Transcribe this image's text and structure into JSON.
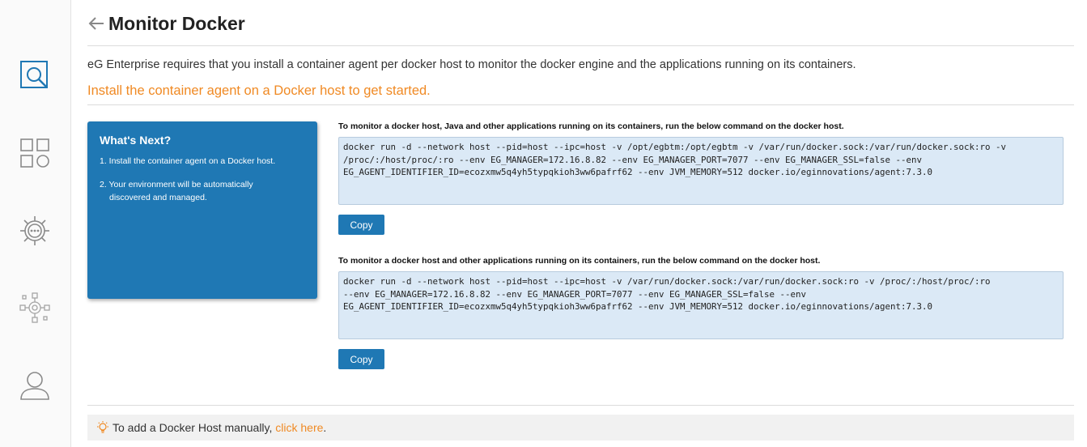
{
  "page": {
    "title": "Monitor Docker",
    "intro": "eG Enterprise requires that you install a container agent per docker host to monitor the docker engine and the applications running on its containers.",
    "cta": "Install the container agent on a Docker host to get started."
  },
  "sidebar": {
    "items": [
      {
        "name": "monitor",
        "icon": "search-monitor-icon"
      },
      {
        "name": "dashboards",
        "icon": "grid-icon"
      },
      {
        "name": "admin",
        "icon": "gear-icon"
      },
      {
        "name": "configure",
        "icon": "network-gear-icon"
      },
      {
        "name": "user",
        "icon": "user-icon"
      }
    ]
  },
  "whats_next": {
    "title": "What's Next?",
    "step1": "1. Install the container agent on a Docker host.",
    "step2": "2. Your environment will be automatically discovered and managed."
  },
  "commands": [
    {
      "label": "To monitor a docker host, Java and other applications running on its containers, run the below command on the docker host.",
      "command": "docker run -d --network host --pid=host --ipc=host -v /opt/egbtm:/opt/egbtm -v /var/run/docker.sock:/var/run/docker.sock:ro -v\n/proc/:/host/proc/:ro --env EG_MANAGER=172.16.8.82 --env EG_MANAGER_PORT=7077 --env EG_MANAGER_SSL=false --env\nEG_AGENT_IDENTIFIER_ID=ecozxmw5q4yh5typqkioh3ww6pafrf62 --env JVM_MEMORY=512 docker.io/eginnovations/agent:7.3.0",
      "copy_label": "Copy"
    },
    {
      "label": "To monitor a docker host and other applications running on its containers, run the below command on the docker host.",
      "command": "docker run -d --network host --pid=host --ipc=host -v /var/run/docker.sock:/var/run/docker.sock:ro -v /proc/:/host/proc/:ro\n--env EG_MANAGER=172.16.8.82 --env EG_MANAGER_PORT=7077 --env EG_MANAGER_SSL=false --env\nEG_AGENT_IDENTIFIER_ID=ecozxmw5q4yh5typqkioh3ww6pafrf62 --env JVM_MEMORY=512 docker.io/eginnovations/agent:7.3.0",
      "copy_label": "Copy"
    }
  ],
  "footer": {
    "text": "To add a Docker Host manually, ",
    "link": "click here",
    "suffix": ".",
    "icon": "lightbulb-icon"
  },
  "colors": {
    "accent": "#1f78b4",
    "highlight": "#f08a24",
    "command_bg": "#dbe9f6"
  }
}
